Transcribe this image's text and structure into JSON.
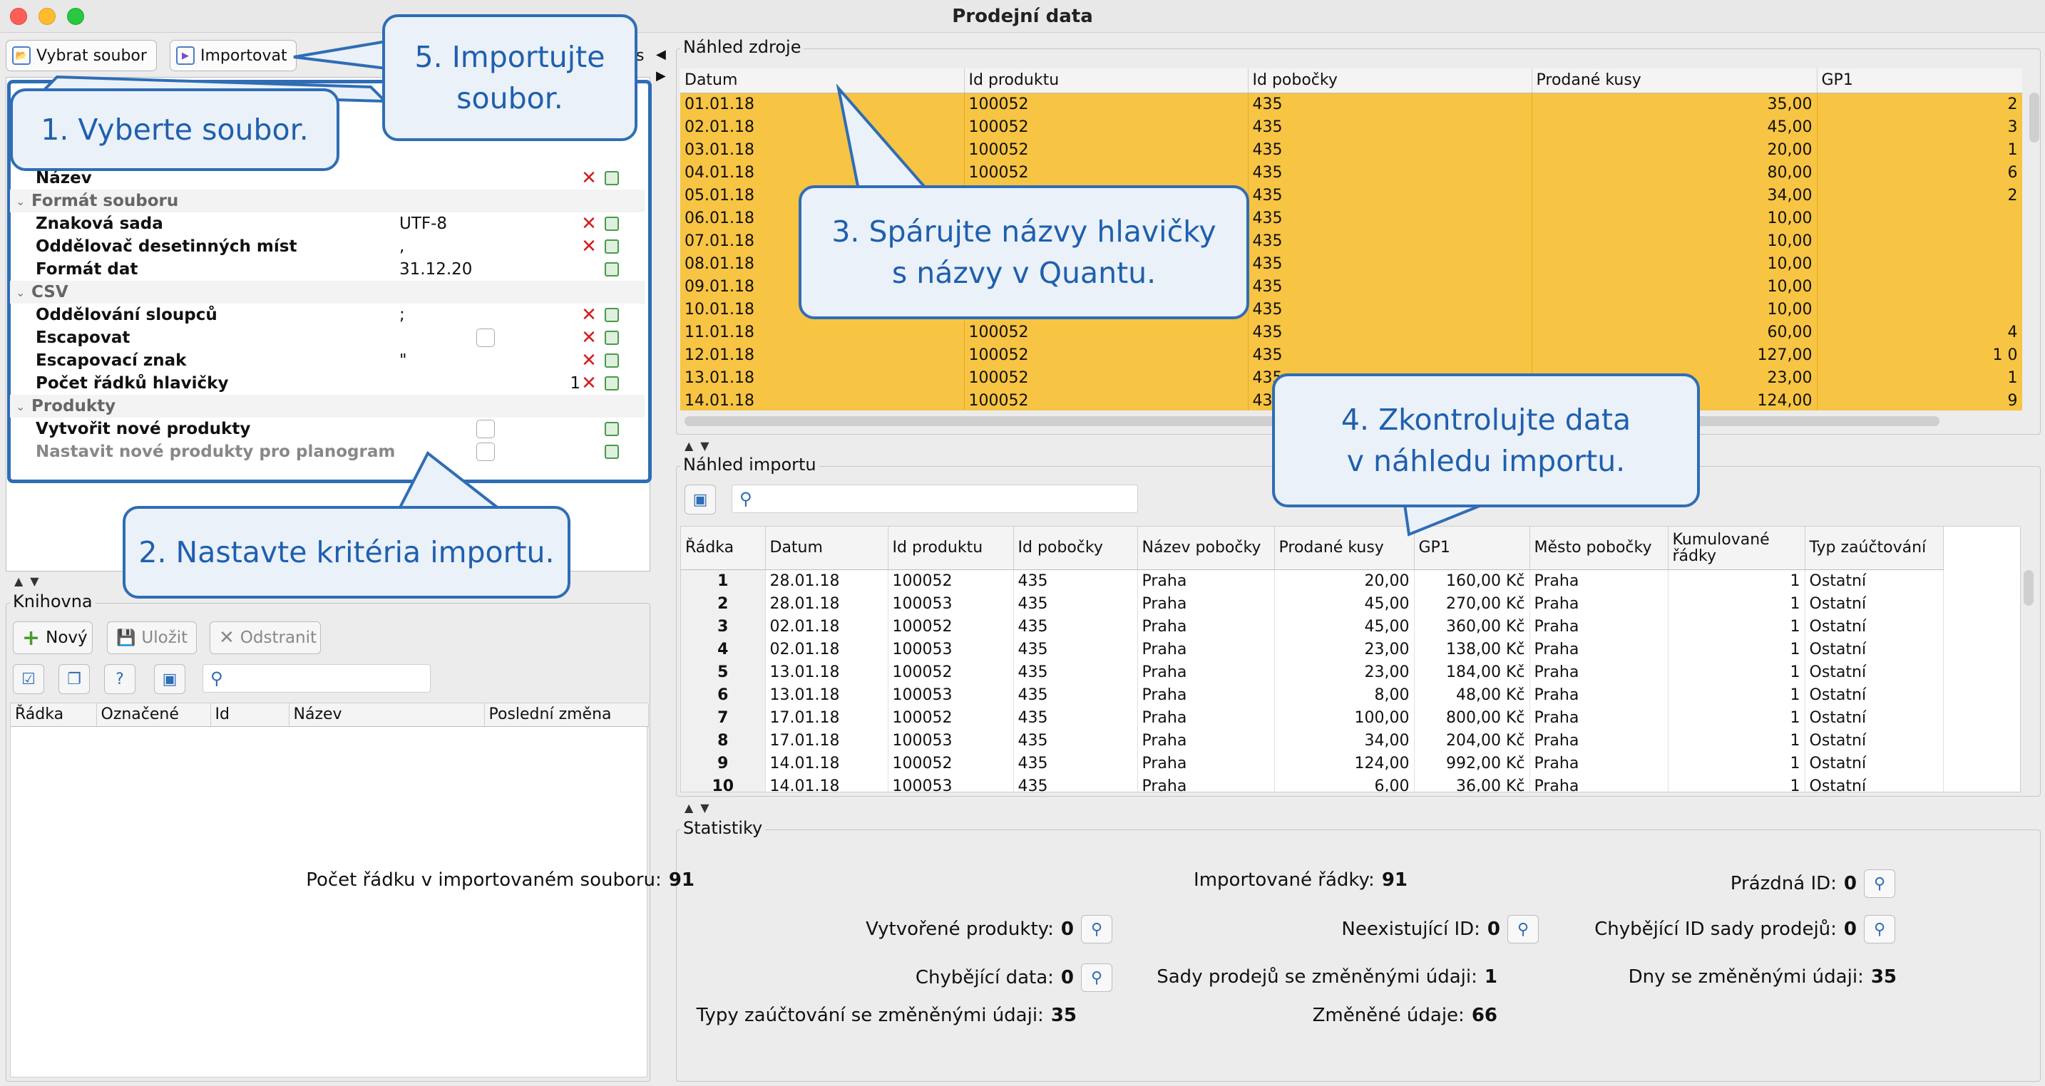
{
  "window": {
    "title": "Prodejní data"
  },
  "toolbar": {
    "select_file": "Vybrat soubor",
    "import": "Importovat",
    "settings_tail": "s"
  },
  "properties": {
    "rows": [
      {
        "kind": "prop",
        "label": "Název",
        "value": "",
        "x": true
      },
      {
        "kind": "cat",
        "label": "Formát souboru"
      },
      {
        "kind": "prop",
        "label": "Znaková sada",
        "value": "UTF-8",
        "x": true
      },
      {
        "kind": "prop",
        "label": "Oddělovač desetinných míst",
        "value": ",",
        "x": true
      },
      {
        "kind": "prop",
        "label": "Formát dat",
        "value": "31.12.20",
        "x": false
      },
      {
        "kind": "cat",
        "label": "CSV"
      },
      {
        "kind": "prop",
        "label": "Oddělování sloupců",
        "value": ";",
        "x": true
      },
      {
        "kind": "prop",
        "label": "Escapovat",
        "value": "",
        "checkbox": true,
        "x": true
      },
      {
        "kind": "prop",
        "label": "Escapovací znak",
        "value": "\"",
        "x": true
      },
      {
        "kind": "prop",
        "label": "Počet řádků hlavičky",
        "value": "1",
        "x": true
      },
      {
        "kind": "cat",
        "label": "Produkty"
      },
      {
        "kind": "prop",
        "label": "Vytvořit nové produkty",
        "value": "",
        "checkbox": true,
        "x": false
      },
      {
        "kind": "prop",
        "label": "Nastavit nové produkty pro planogramy",
        "value": "",
        "checkbox": true,
        "x": false,
        "disabled": true
      }
    ]
  },
  "library": {
    "title": "Knihovna",
    "new": "Nový",
    "save": "Uložit",
    "remove": "Odstranit",
    "columns": [
      "Řádka",
      "Označené",
      "Id",
      "Název",
      "Poslední změna"
    ]
  },
  "source_preview": {
    "title": "Náhled zdroje",
    "columns": [
      "Datum",
      "Id produktu",
      "Id pobočky",
      "Prodané kusy",
      "GP1"
    ],
    "rows": [
      [
        "01.01.18",
        "100052",
        "435",
        "35,00",
        "2"
      ],
      [
        "02.01.18",
        "100052",
        "435",
        "45,00",
        "3"
      ],
      [
        "03.01.18",
        "100052",
        "435",
        "20,00",
        "1"
      ],
      [
        "04.01.18",
        "100052",
        "435",
        "80,00",
        "6"
      ],
      [
        "05.01.18",
        "",
        "435",
        "34,00",
        "2"
      ],
      [
        "06.01.18",
        "",
        "435",
        "10,00",
        ""
      ],
      [
        "07.01.18",
        "",
        "435",
        "10,00",
        ""
      ],
      [
        "08.01.18",
        "",
        "435",
        "10,00",
        ""
      ],
      [
        "09.01.18",
        "",
        "435",
        "10,00",
        ""
      ],
      [
        "10.01.18",
        "",
        "435",
        "10,00",
        ""
      ],
      [
        "11.01.18",
        "100052",
        "435",
        "60,00",
        "4"
      ],
      [
        "12.01.18",
        "100052",
        "435",
        "127,00",
        "1 0"
      ],
      [
        "13.01.18",
        "100052",
        "435",
        "23,00",
        "1"
      ],
      [
        "14.01.18",
        "100052",
        "43",
        "124,00",
        "9"
      ]
    ]
  },
  "import_preview": {
    "title": "Náhled importu",
    "columns": [
      "Řádka",
      "Datum",
      "Id produktu",
      "Id pobočky",
      "Název pobočky",
      "Prodané kusy",
      "GP1",
      "Město pobočky",
      "Kumulované řádky",
      "Typ zaúčtování"
    ],
    "rows": [
      [
        "1",
        "28.01.18",
        "100052",
        "435",
        "Praha",
        "20,00",
        "160,00 Kč",
        "Praha",
        "1",
        "Ostatní"
      ],
      [
        "2",
        "28.01.18",
        "100053",
        "435",
        "Praha",
        "45,00",
        "270,00 Kč",
        "Praha",
        "1",
        "Ostatní"
      ],
      [
        "3",
        "02.01.18",
        "100052",
        "435",
        "Praha",
        "45,00",
        "360,00 Kč",
        "Praha",
        "1",
        "Ostatní"
      ],
      [
        "4",
        "02.01.18",
        "100053",
        "435",
        "Praha",
        "23,00",
        "138,00 Kč",
        "Praha",
        "1",
        "Ostatní"
      ],
      [
        "5",
        "13.01.18",
        "100052",
        "435",
        "Praha",
        "23,00",
        "184,00 Kč",
        "Praha",
        "1",
        "Ostatní"
      ],
      [
        "6",
        "13.01.18",
        "100053",
        "435",
        "Praha",
        "8,00",
        "48,00 Kč",
        "Praha",
        "1",
        "Ostatní"
      ],
      [
        "7",
        "17.01.18",
        "100052",
        "435",
        "Praha",
        "100,00",
        "800,00 Kč",
        "Praha",
        "1",
        "Ostatní"
      ],
      [
        "8",
        "17.01.18",
        "100053",
        "435",
        "Praha",
        "34,00",
        "204,00 Kč",
        "Praha",
        "1",
        "Ostatní"
      ],
      [
        "9",
        "14.01.18",
        "100052",
        "435",
        "Praha",
        "124,00",
        "992,00 Kč",
        "Praha",
        "1",
        "Ostatní"
      ],
      [
        "10",
        "14.01.18",
        "100053",
        "435",
        "Praha",
        "6,00",
        "36,00 Kč",
        "Praha",
        "1",
        "Ostatní"
      ]
    ]
  },
  "statistics": {
    "title": "Statistiky",
    "items": [
      {
        "label": "Počet řádku v importovaném souboru:",
        "value": "91"
      },
      {
        "label": "Importované řádky:",
        "value": "91"
      },
      {
        "label": "Prázdná ID:",
        "value": "0"
      },
      {
        "label": "Vytvořené produkty:",
        "value": "0"
      },
      {
        "label": "Neexistující ID:",
        "value": "0"
      },
      {
        "label": "Chybějící ID sady prodejů:",
        "value": "0"
      },
      {
        "label": "Chybějící data:",
        "value": "0"
      },
      {
        "label": "Sady prodejů se změněnými údaji:",
        "value": "1"
      },
      {
        "label": "Dny se změněnými údaji:",
        "value": "35"
      },
      {
        "label": "Typy zaúčtování se změněnými údaji:",
        "value": "35"
      },
      {
        "label": "Změněné údaje:",
        "value": "66"
      }
    ]
  },
  "callouts": {
    "step1": "1. Vyberte soubor.",
    "step2": "2. Nastavte kritéria importu.",
    "step3_l1": "3. Spárujte názvy hlavičky",
    "step3_l2": "s názvy v Quantu.",
    "step4_l1": "4. Zkontrolujte data",
    "step4_l2": "v náhledu importu.",
    "step5_l1": "5. Importujte",
    "step5_l2": "soubor."
  },
  "colors": {
    "accent": "#2f6db5",
    "highlight_rows": "#f7c443",
    "remove_x": "#d41e1e"
  }
}
